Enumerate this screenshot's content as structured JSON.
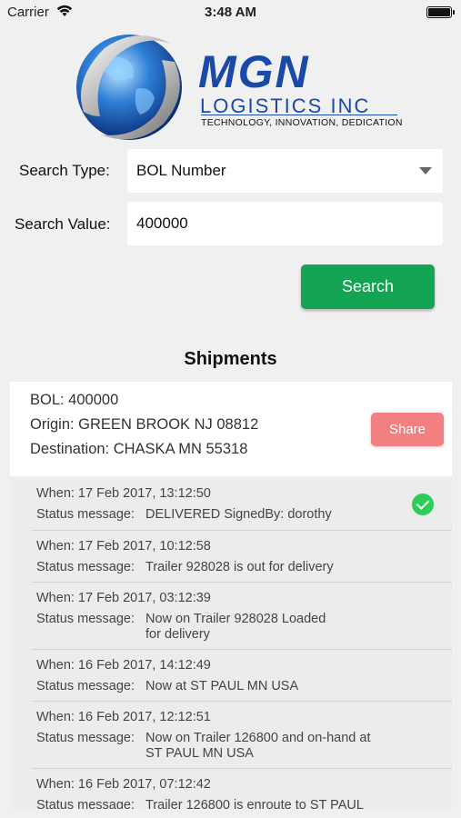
{
  "status_bar": {
    "carrier": "Carrier",
    "time": "3:48 AM"
  },
  "logo": {
    "main": "MGN",
    "sub": "LOGISTICS INC",
    "tagline": "TECHNOLOGY, INNOVATION, DEDICATION",
    "brand_color": "#1a4aa8"
  },
  "search": {
    "type_label": "Search Type:",
    "type_value": "BOL Number",
    "value_label": "Search Value:",
    "value_value": "400000",
    "button_label": "Search",
    "button_color": "#13a454"
  },
  "shipments": {
    "title": "Shipments",
    "card": {
      "bol": "BOL: 400000",
      "origin": "Origin: GREEN BROOK NJ 08812",
      "destination": "Destination: CHASKA MN 55318",
      "share_label": "Share",
      "share_color": "#f28080"
    },
    "statuses": [
      {
        "when": "When: 17 Feb 2017, 13:12:50",
        "label": "Status message:",
        "message": "DELIVERED SignedBy: dorothy",
        "icon": "check-circle-icon"
      },
      {
        "when": "When: 17 Feb 2017, 10:12:58",
        "label": "Status message:",
        "message": "Trailer 928028 is out for delivery"
      },
      {
        "when": "When: 17 Feb 2017, 03:12:39",
        "label": "Status message:",
        "message_line1": "Now on Trailer 928028 Loaded",
        "message_line2": "for delivery"
      },
      {
        "when": "When: 16 Feb 2017, 14:12:49",
        "label": "Status message:",
        "message": "Now at ST PAUL MN USA"
      },
      {
        "when": "When: 16 Feb 2017, 12:12:51",
        "label": "Status message:",
        "message_line1": "Now on Trailer 126800 and on-hand at",
        "message_line2": "ST PAUL MN USA"
      },
      {
        "when": "When: 16 Feb 2017, 07:12:42",
        "label": "Status message:",
        "message": "Trailer 126800 is enroute to ST PAUL"
      }
    ]
  }
}
